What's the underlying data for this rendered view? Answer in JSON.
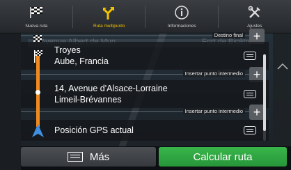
{
  "tabs": [
    {
      "label": "Nueva ruta",
      "icon": "checkered-flag-icon"
    },
    {
      "label": "Ruta multipunto",
      "icon": "route-split-icon",
      "active": true
    },
    {
      "label": "Informaciones",
      "icon": "info-icon"
    },
    {
      "label": "Ajustes",
      "icon": "tools-icon"
    }
  ],
  "map": {
    "streets": [
      "Avenue Albert de Mun",
      "Fort de Bicêtre"
    ]
  },
  "route": {
    "final_destination_label": "Destino final",
    "insert_label": "Insertar punto intermedio",
    "stops": [
      {
        "line1": "Troyes",
        "line2": "Aube, Francia"
      },
      {
        "line1": "14, Avenue d'Alsace-Lorraine",
        "line2": "Limeil-Brévannes"
      },
      {
        "line1": "Posición GPS actual",
        "line2": ""
      }
    ]
  },
  "buttons": {
    "more": "Más",
    "calculate": "Calcular ruta"
  },
  "colors": {
    "accent_tab": "#f2c400",
    "route": "#f08a1e",
    "calculate": "#2fa842"
  }
}
